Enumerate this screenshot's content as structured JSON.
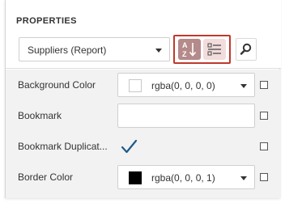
{
  "panel": {
    "title": "PROPERTIES"
  },
  "component_select": {
    "value": "Suppliers (Report)",
    "icon": "chevron-down-icon"
  },
  "sort_buttons": {
    "alphabetical_icon": "sort-az-icon",
    "categorized_icon": "categorized-list-icon",
    "active": "alphabetical"
  },
  "search": {
    "icon": "search-icon"
  },
  "properties": [
    {
      "label": "Background Color",
      "value": "rgba(0, 0, 0, 0)",
      "swatch_color": "#ffffff"
    },
    {
      "label": "Bookmark",
      "value": ""
    },
    {
      "label": "Bookmark Duplicat...",
      "checked": true
    },
    {
      "label": "Border Color",
      "value": "rgba(0, 0, 0, 1)",
      "swatch_color": "#000000"
    }
  ],
  "colors": {
    "highlight_border": "#c0392b",
    "active_button": "#b58a8a",
    "inactive_button": "#f3dcdc",
    "check_color": "#1f5a8b",
    "rows_background": "#f2f2f2"
  }
}
